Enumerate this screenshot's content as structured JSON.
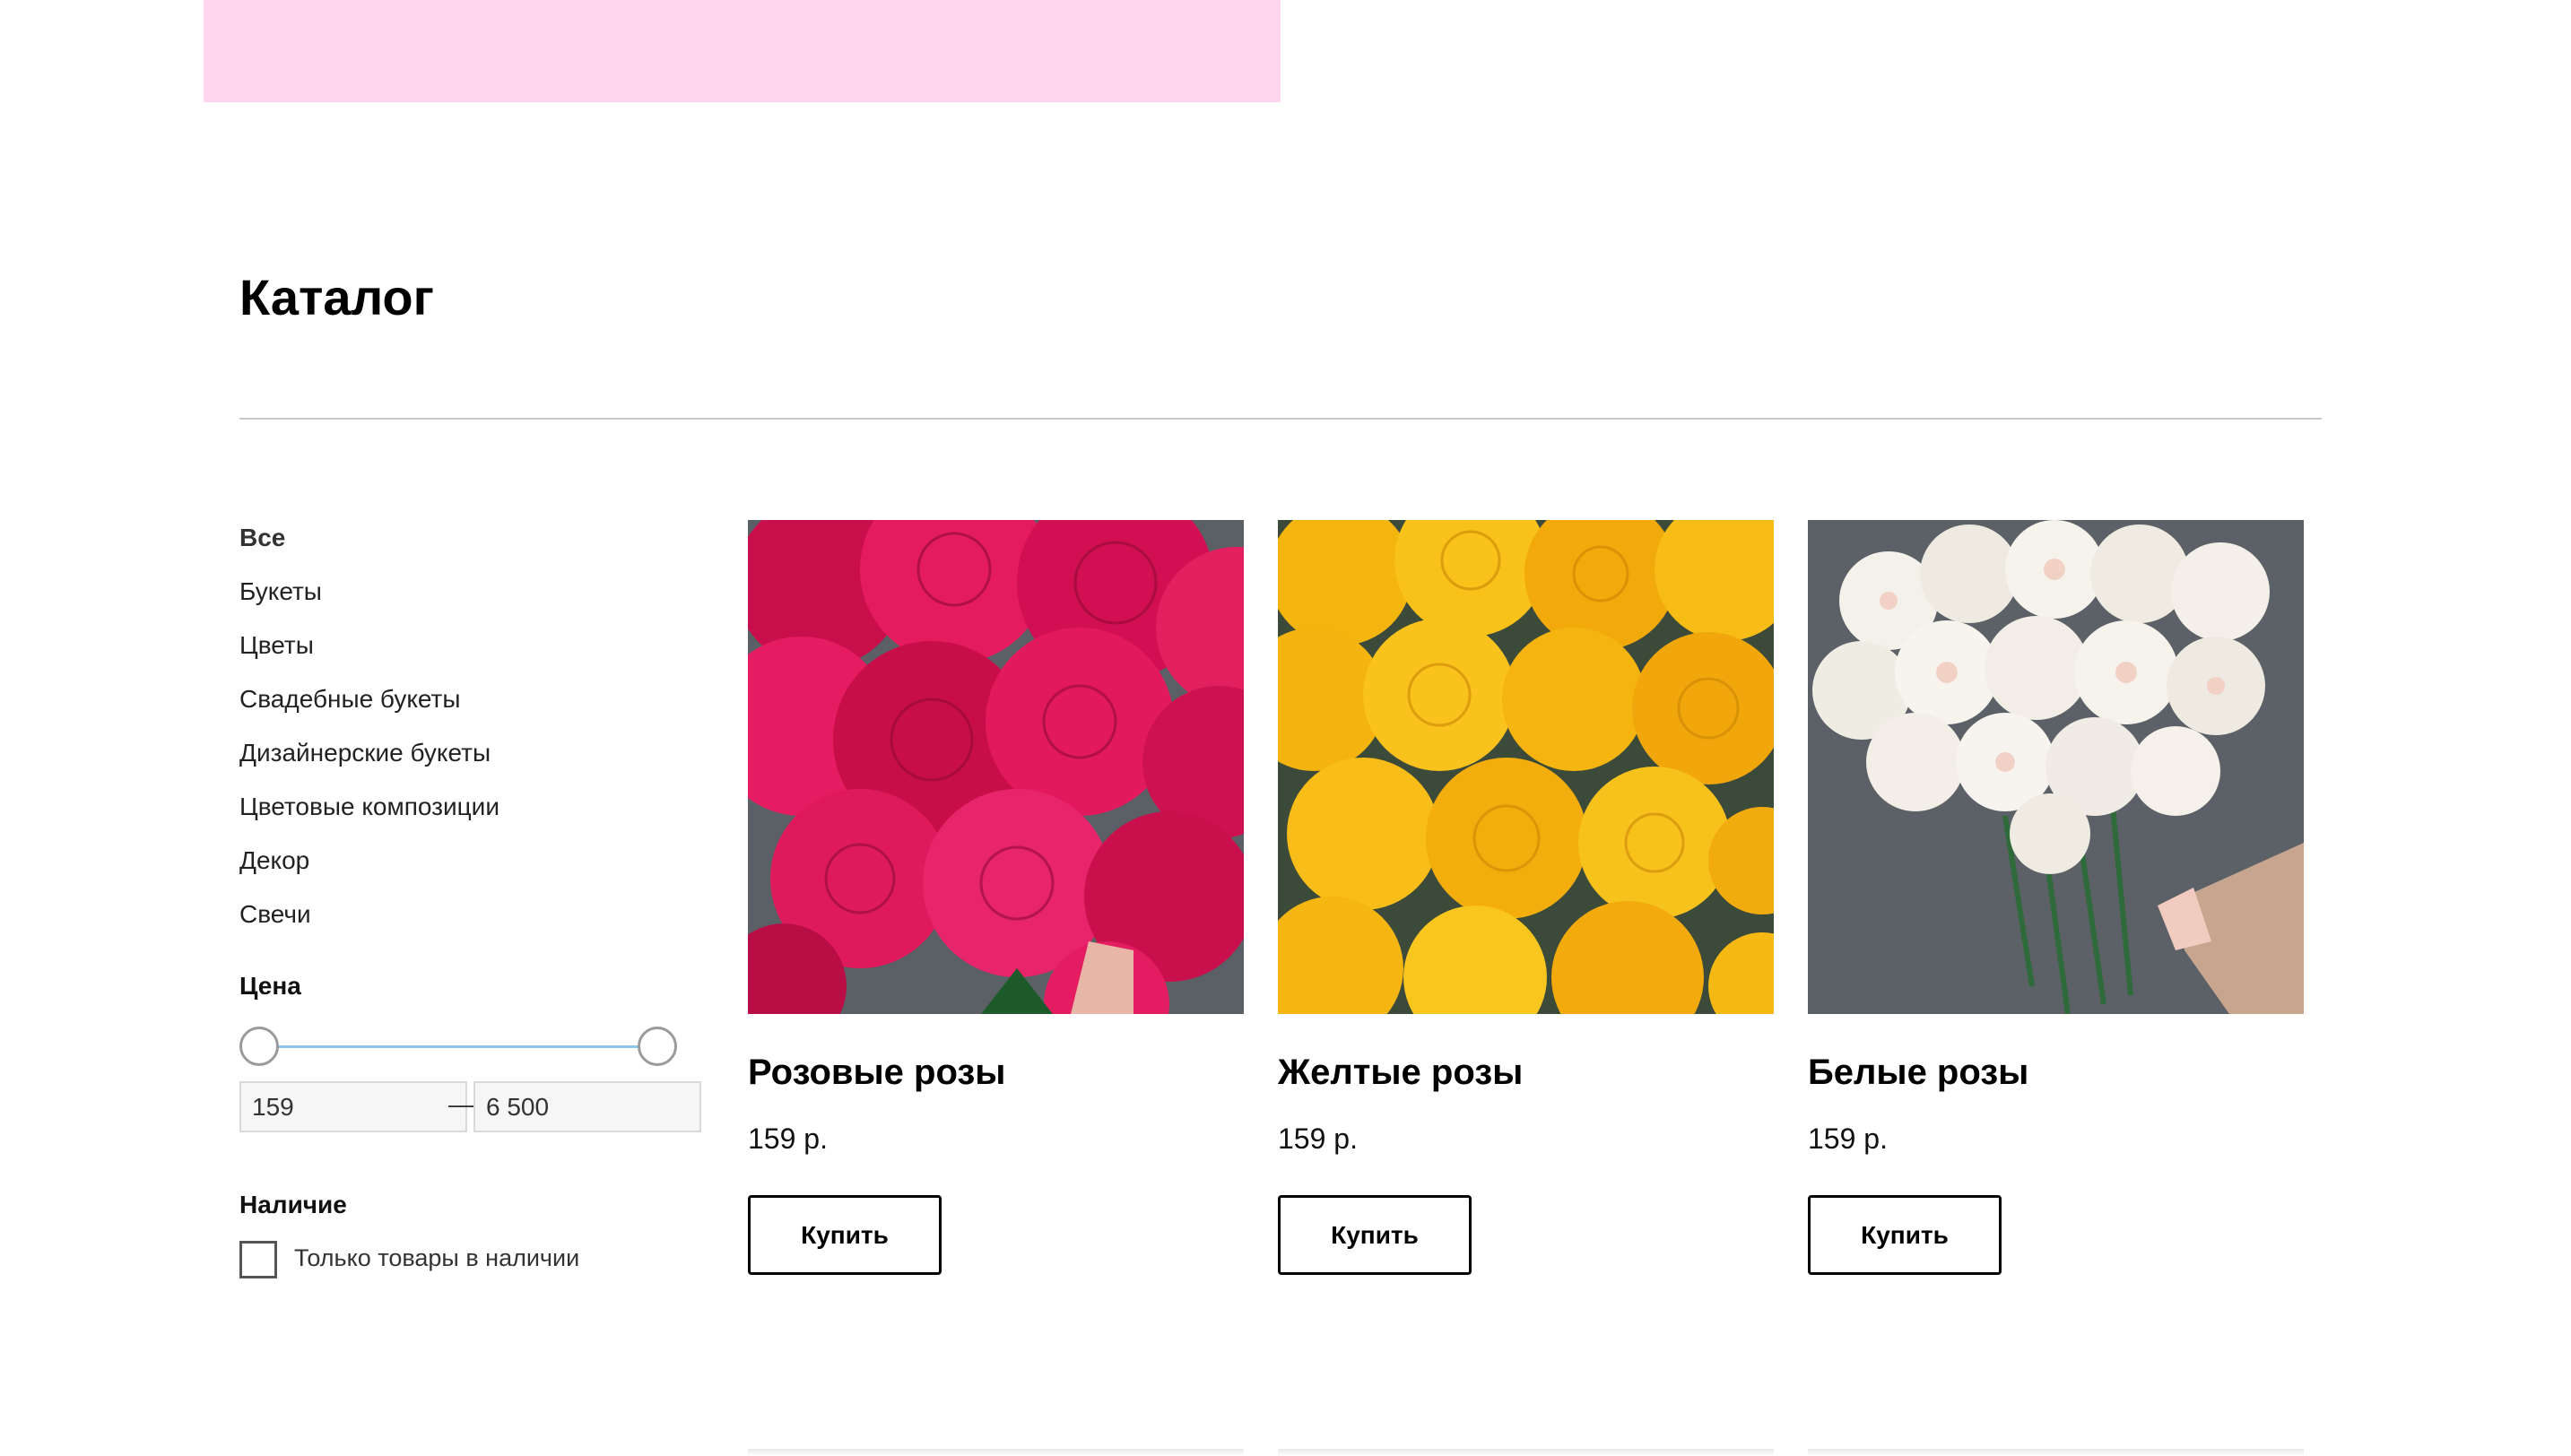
{
  "catalog": {
    "title": "Каталог"
  },
  "filters": {
    "categories": [
      {
        "label": "Все",
        "active": true
      },
      {
        "label": "Букеты",
        "active": false
      },
      {
        "label": "Цветы",
        "active": false
      },
      {
        "label": "Свадебные букеты",
        "active": false
      },
      {
        "label": "Дизайнерские букеты",
        "active": false
      },
      {
        "label": "Цветовые композиции",
        "active": false
      },
      {
        "label": "Декор",
        "active": false
      },
      {
        "label": "Свечи",
        "active": false
      }
    ],
    "price": {
      "title": "Цена",
      "min_value": "159",
      "max_value": "6 500",
      "separator": "—"
    },
    "availability": {
      "title": "Наличие",
      "checkbox_label": "Только товары в наличии",
      "checked": false
    }
  },
  "products": [
    {
      "title": "Розовые розы",
      "price": "159 р.",
      "button": "Купить",
      "image_color": "#e0145a"
    },
    {
      "title": "Желтые розы",
      "price": "159 р.",
      "button": "Купить",
      "image_color": "#f7b10f"
    },
    {
      "title": "Белые розы",
      "price": "159 р.",
      "button": "Купить",
      "image_color": "#f2efe8"
    }
  ],
  "colors": {
    "banner": "#ffd4ef",
    "slider_track": "#8ec5ea",
    "text": "#000000"
  }
}
